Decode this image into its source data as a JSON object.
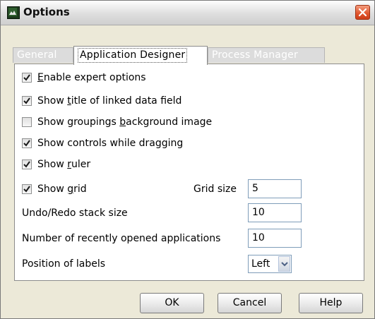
{
  "window": {
    "title": "Options"
  },
  "tabs": [
    {
      "label": "General",
      "active": false
    },
    {
      "label": "Application Designer",
      "active": true
    },
    {
      "label": "Process Manager",
      "active": false
    }
  ],
  "options": {
    "enable_expert": {
      "pre": "",
      "u": "E",
      "post": "nable expert options",
      "checked": true
    },
    "show_title": {
      "pre": "Show ",
      "u": "t",
      "post": "itle of linked data field",
      "checked": true
    },
    "show_groupings": {
      "pre": "Show groupings ",
      "u": "b",
      "post": "ackground image",
      "checked": false
    },
    "show_controls": {
      "pre": "Show controls while dragging",
      "u": "",
      "post": "",
      "checked": true
    },
    "show_ruler": {
      "pre": "Show ",
      "u": "r",
      "post": "uler",
      "checked": true
    },
    "show_grid": {
      "pre": "Show ",
      "u": "g",
      "post": "rid",
      "checked": true
    }
  },
  "grid_size": {
    "label": "Grid size",
    "value": "5"
  },
  "undo_redo": {
    "label": "Undo/Redo stack size",
    "value": "10"
  },
  "recent_apps": {
    "label": "Number of recently opened applications",
    "value": "10"
  },
  "label_position": {
    "label": "Position of labels",
    "value": "Left"
  },
  "buttons": {
    "ok": "OK",
    "cancel": "Cancel",
    "help": "Help"
  },
  "icons": {
    "app": "options-app-icon",
    "close": "close-icon",
    "check": "checkmark-icon",
    "dropdown": "chevron-down-icon"
  }
}
